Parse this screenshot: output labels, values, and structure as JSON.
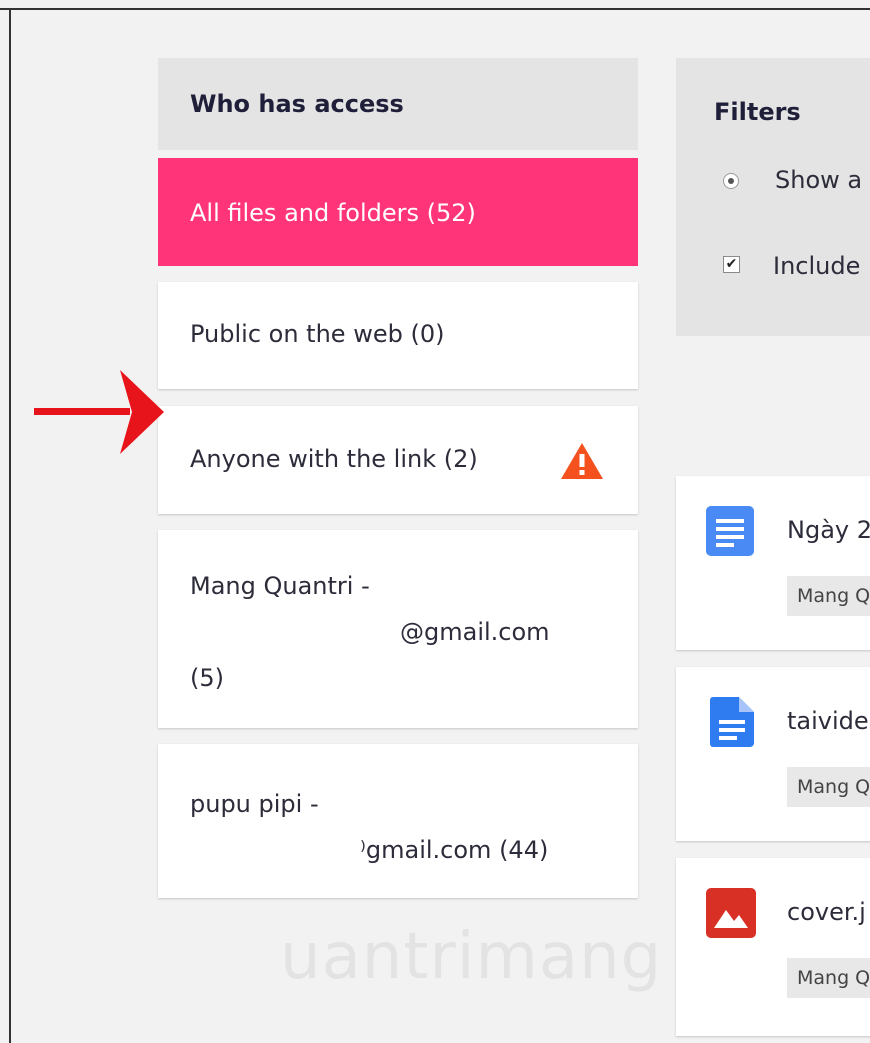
{
  "sidebar": {
    "title": "Who has access",
    "items": [
      {
        "line1": "All files and folders (52)"
      },
      {
        "line1": "Public on the web (0)"
      },
      {
        "line1": "Anyone with the link (2)"
      },
      {
        "line1": "Mang Quantri -",
        "line2": "@gmail.com",
        "line3": "(5)"
      },
      {
        "line1": "pupu pipi -",
        "line2": "⁾gmail.com (44)"
      }
    ]
  },
  "filters": {
    "title": "Filters",
    "option_show": "Show a",
    "option_include": "Include"
  },
  "files": [
    {
      "name": "Ngày 2",
      "owner": "Mang Q",
      "icon": "docs-icon"
    },
    {
      "name": "taivide",
      "owner": "Mang Q",
      "icon": "file-icon"
    },
    {
      "name": "cover.j",
      "owner": "Mang Q",
      "icon": "image-icon"
    }
  ],
  "colors": {
    "accent": "#ff3479",
    "docs_blue": "#4a8af4",
    "image_red": "#d93025",
    "warning_orange": "#f4511e",
    "arrow_red": "#e8141b"
  },
  "watermark": "uantrimang"
}
